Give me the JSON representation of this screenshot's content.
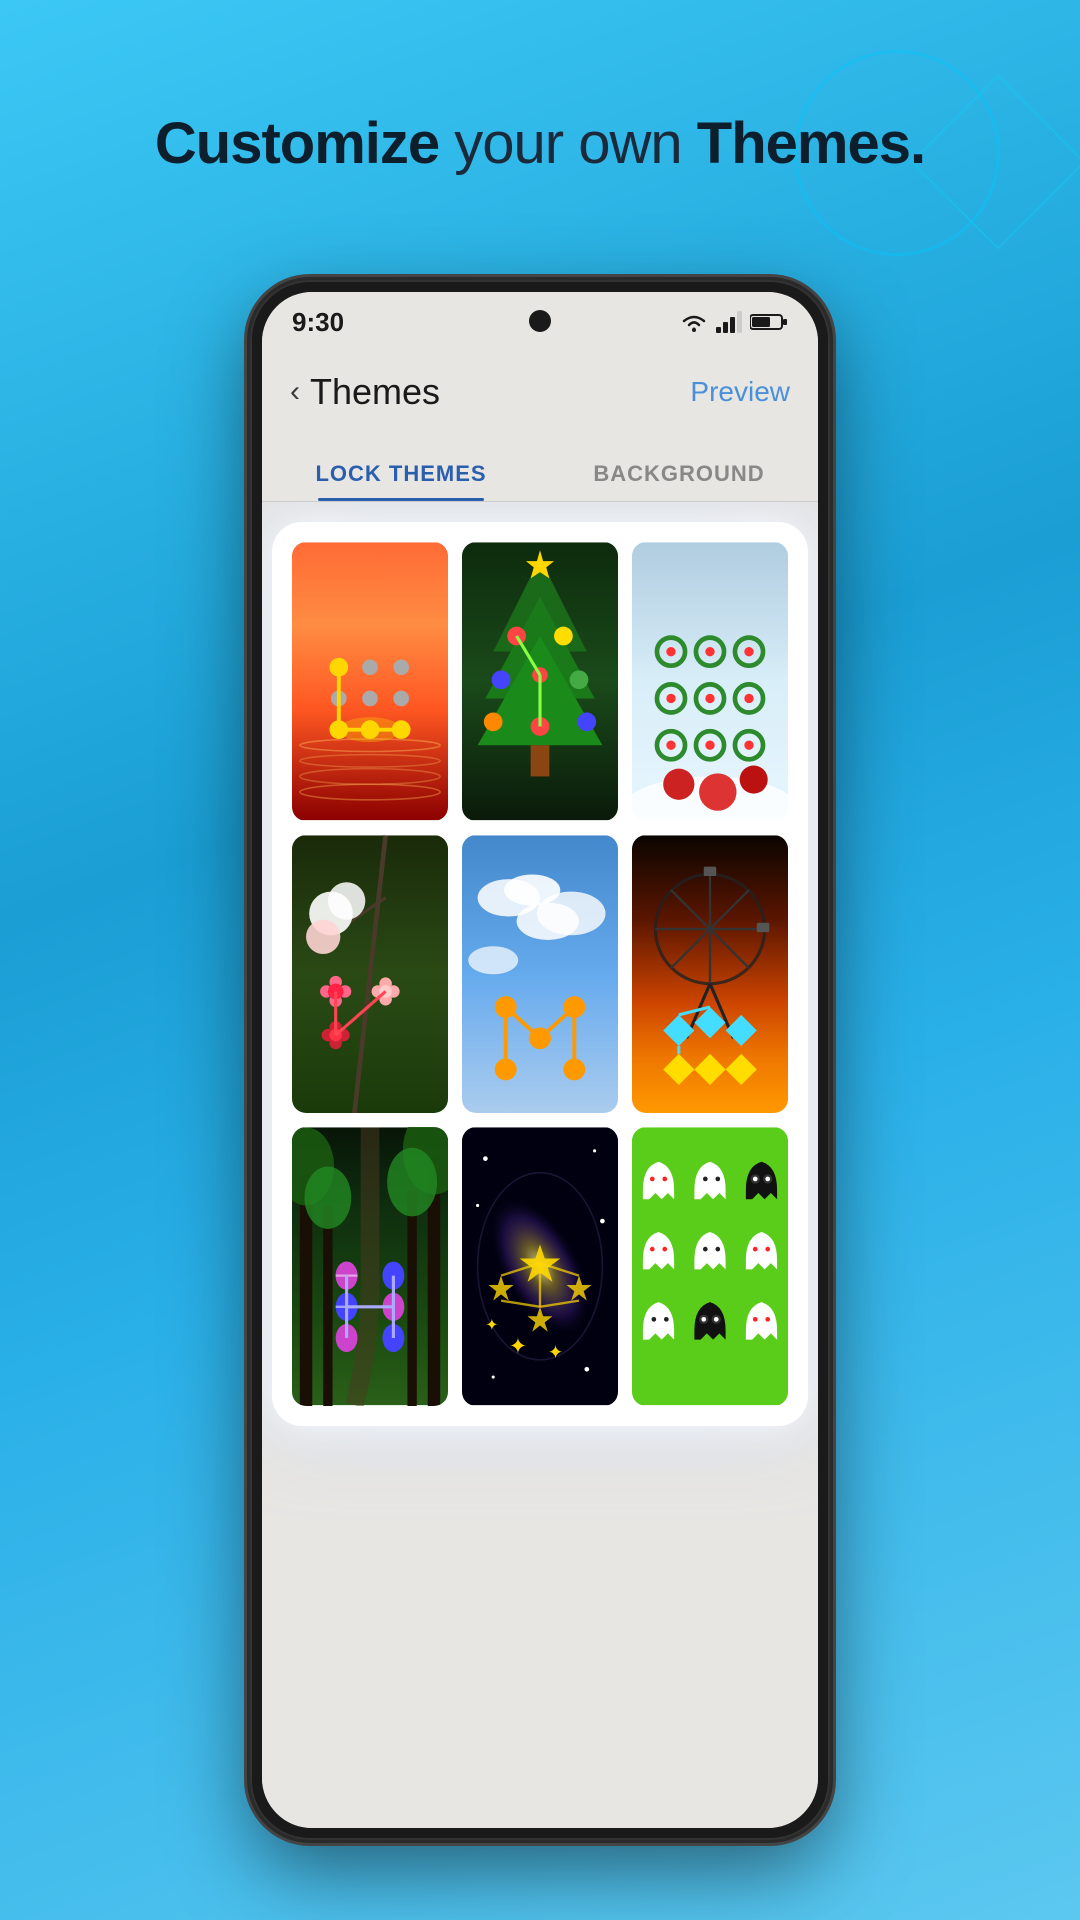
{
  "page": {
    "background_gradient": "linear-gradient(160deg, #3cc8f5 0%, #1a9ed4 40%, #2ab0e8 60%, #5bc8f0 100%)",
    "header": {
      "line1_normal": "your own",
      "line1_bold_start": "Customize",
      "line1_bold_end": "Themes.",
      "full_text": "Customize your own Themes."
    }
  },
  "status_bar": {
    "time": "9:30",
    "wifi": "wifi-icon",
    "signal": "signal-icon",
    "battery": "battery-icon"
  },
  "app_header": {
    "back_label": "‹",
    "title": "Themes",
    "preview_label": "Preview"
  },
  "tabs": [
    {
      "id": "lock-themes",
      "label": "LOCK THEMES",
      "active": true
    },
    {
      "id": "background",
      "label": "BACKGROUND",
      "active": false
    }
  ],
  "themes": [
    {
      "id": "theme-1",
      "type": "sunset",
      "name": "Sunset Water"
    },
    {
      "id": "theme-2",
      "type": "christmas-tree",
      "name": "Christmas Tree"
    },
    {
      "id": "theme-3",
      "type": "snow",
      "name": "Snow Christmas"
    },
    {
      "id": "theme-4",
      "type": "flowers",
      "name": "Flowers"
    },
    {
      "id": "theme-5",
      "type": "clouds",
      "name": "Clouds"
    },
    {
      "id": "theme-6",
      "type": "ferris",
      "name": "Ferris Wheel"
    },
    {
      "id": "theme-7",
      "type": "forest",
      "name": "Forest Path"
    },
    {
      "id": "theme-8",
      "type": "galaxy",
      "name": "Galaxy"
    },
    {
      "id": "theme-9",
      "type": "ghosts",
      "name": "Ghosts"
    }
  ],
  "colors": {
    "accent_blue": "#2a5fad",
    "preview_blue": "#4a90d9",
    "active_tab_indicator": "#2a5fad"
  }
}
